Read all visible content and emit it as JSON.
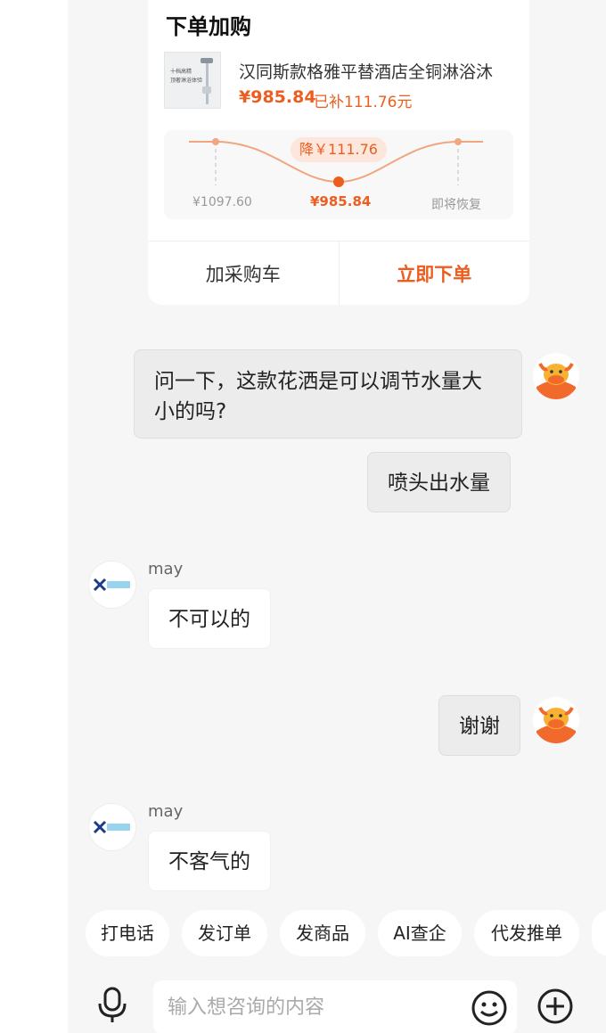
{
  "order_card": {
    "title": "下单加购",
    "product_name": "汉同斯款格雅平替酒店全铜淋浴沐",
    "thumb_text_1": "十档高精",
    "thumb_text_2": "顶奢淋浴体验",
    "price": "¥985.84",
    "subsidy": "已补111.76元",
    "price_drop_badge": "降￥111.76",
    "chart_labels": {
      "original": "¥1097.60",
      "current": "¥985.84",
      "restore": "即将恢复"
    },
    "add_to_cart": "加采购车",
    "buy_now": "立即下单",
    "accent_color": "#ec5e1f"
  },
  "messages": [
    {
      "side": "right",
      "text": "问一下，这款花洒是可以调节水量大小的吗?"
    },
    {
      "side": "right",
      "text": "喷头出水量"
    },
    {
      "side": "left",
      "sender": "may",
      "text": "不可以的"
    },
    {
      "side": "right",
      "text": "谢谢"
    },
    {
      "side": "left",
      "sender": "may",
      "text": "不客气的"
    }
  ],
  "quick_replies": [
    "打电话",
    "发订单",
    "发商品",
    "AI查企",
    "代发推单"
  ],
  "input": {
    "placeholder": "输入想咨询的内容",
    "voice_icon": "microphone-icon",
    "emoji_icon": "emoji-icon",
    "plus_icon": "plus-icon"
  }
}
